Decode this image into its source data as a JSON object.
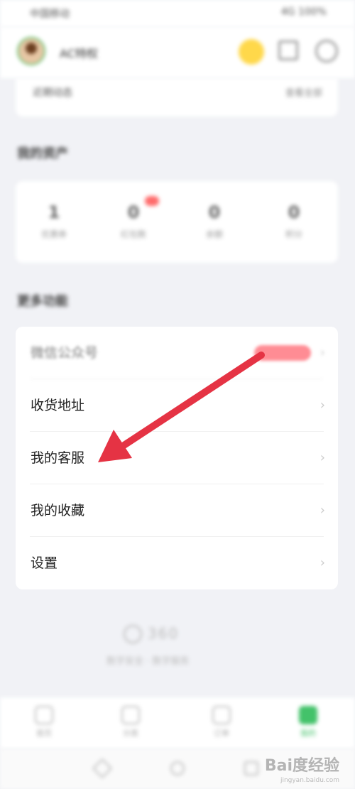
{
  "status_bar": {
    "left": "中国移动",
    "right": "4G 100%"
  },
  "header": {
    "username": "AC特权"
  },
  "top_card": {
    "title": "近期动态",
    "more": "查看全部"
  },
  "assets_section": {
    "title": "我的资产",
    "items": [
      {
        "value": "1",
        "label": "优惠券"
      },
      {
        "value": "0",
        "label": "红包数"
      },
      {
        "value": "0",
        "label": "余额"
      },
      {
        "value": "0",
        "label": "积分"
      }
    ]
  },
  "services_section": {
    "title": "更多功能",
    "items": [
      {
        "label": "微信公众号"
      },
      {
        "label": "收货地址"
      },
      {
        "label": "我的客服"
      },
      {
        "label": "我的收藏"
      },
      {
        "label": "设置"
      }
    ]
  },
  "footer": {
    "brand": "360",
    "tagline": "数字安全 · 数字服务"
  },
  "tabs": [
    {
      "label": "首页"
    },
    {
      "label": "分类"
    },
    {
      "label": "订单"
    },
    {
      "label": "我的"
    }
  ],
  "watermark": {
    "main": "Bai度经验",
    "sub": "jingyan.baidu.com"
  },
  "colors": {
    "accent": "#43c26a",
    "arrow": "#e53344",
    "badge": "#ff6b6b"
  }
}
